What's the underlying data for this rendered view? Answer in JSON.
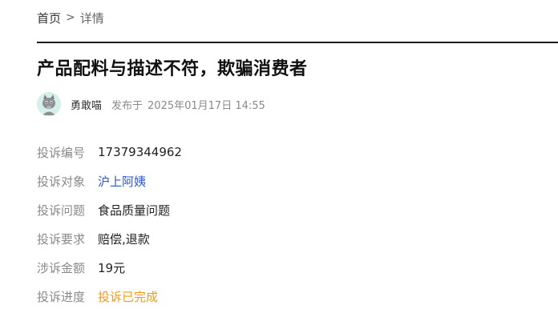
{
  "breadcrumb": {
    "home": "首页",
    "separator": ">",
    "current": "详情"
  },
  "title": "产品配料与描述不符，欺骗消费者",
  "meta": {
    "avatar_icon": "cat-avatar-icon",
    "author": "勇敢喵",
    "published_prefix": "发布于",
    "published_date": "2025年01月17日 14:55"
  },
  "details": [
    {
      "label": "投诉编号",
      "value": "17379344962"
    },
    {
      "label": "投诉对象",
      "value": "沪上阿姨"
    },
    {
      "label": "投诉问题",
      "value": "食品质量问题"
    },
    {
      "label": "投诉要求",
      "value": "赔偿,退款"
    },
    {
      "label": "涉诉金额",
      "value": "19元"
    },
    {
      "label": "投诉进度",
      "value": "投诉已完成"
    }
  ],
  "colors": {
    "link": "#2c56c9",
    "status": "#f09a18",
    "label": "#8a8a8a"
  }
}
